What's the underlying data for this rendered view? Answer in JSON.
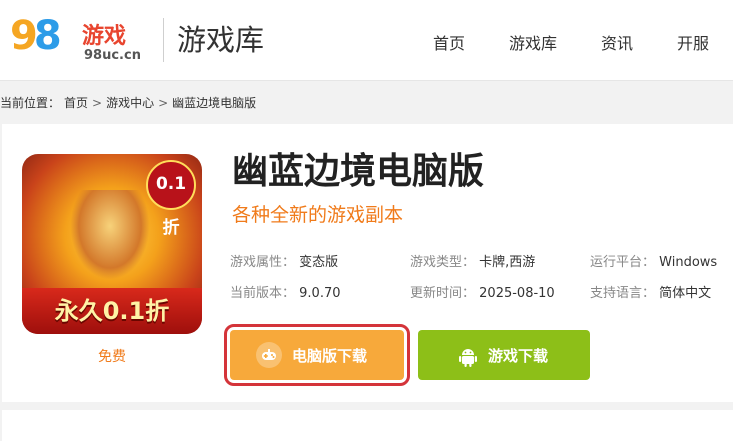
{
  "header": {
    "logo": {
      "digits": "98",
      "brand": "游戏",
      "domain": "98uc.cn"
    },
    "section_title": "游戏库",
    "nav": [
      "首页",
      "游戏库",
      "资讯",
      "开服"
    ]
  },
  "breadcrumb": {
    "prefix": "当前位置：",
    "items": [
      "首页",
      "游戏中心",
      "幽蓝边境电脑版"
    ],
    "separator": ">"
  },
  "game": {
    "title": "幽蓝边境电脑版",
    "subtitle": "各种全新的游戏副本",
    "price": "免费",
    "icon": {
      "name": "game-cover-icon",
      "badge": "0.1折",
      "banner": "永久0.1折"
    },
    "info": {
      "attribute_label": "游戏属性：",
      "attribute": "变态版",
      "type_label": "游戏类型：",
      "type": "卡牌,西游",
      "platform_label": "运行平台：",
      "platform": "Windows",
      "version_label": "当前版本：",
      "version": "9.0.70",
      "update_label": "更新时间：",
      "update": "2025-08-10",
      "language_label": "支持语言：",
      "language": "简体中文"
    },
    "buttons": {
      "pc_download": "电脑版下载",
      "game_download": "游戏下载"
    }
  },
  "colors": {
    "accent_orange": "#f7a93b",
    "green": "#8dbf18",
    "highlight_red": "#d4343a",
    "subtitle_orange": "#f07b1b"
  }
}
